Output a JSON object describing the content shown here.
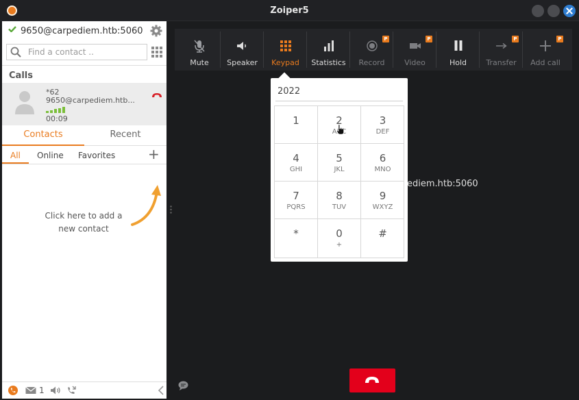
{
  "window": {
    "title": "Zoiper5"
  },
  "account": {
    "name": "9650@carpediem.htb:5060"
  },
  "search": {
    "placeholder": "Find a contact .."
  },
  "calls": {
    "header": "Calls",
    "items": [
      {
        "number": "*62",
        "account": "9650@carpediem.htb...",
        "duration": "00:09"
      }
    ]
  },
  "contacts": {
    "tabs": [
      "Contacts",
      "Recent"
    ],
    "filters": [
      "All",
      "Online",
      "Favorites"
    ],
    "add_hint": "Click here to add a new contact"
  },
  "footer": {
    "message_count": "1"
  },
  "toolbar": {
    "buttons": [
      {
        "label": "Mute",
        "icon": "mic-off-icon",
        "state": "normal"
      },
      {
        "label": "Speaker",
        "icon": "speaker-icon",
        "state": "normal"
      },
      {
        "label": "Keypad",
        "icon": "keypad-icon",
        "state": "active"
      },
      {
        "label": "Statistics",
        "icon": "bar-chart-icon",
        "state": "normal"
      },
      {
        "label": "Record",
        "icon": "record-icon",
        "state": "disabled",
        "badge": "P"
      },
      {
        "label": "Video",
        "icon": "video-icon",
        "state": "disabled",
        "badge": "P"
      },
      {
        "label": "Hold",
        "icon": "pause-icon",
        "state": "normal"
      },
      {
        "label": "Transfer",
        "icon": "transfer-icon",
        "state": "disabled",
        "badge": "P"
      },
      {
        "label": "Add call",
        "icon": "plus-icon",
        "state": "disabled",
        "badge": "P"
      }
    ]
  },
  "main": {
    "host_fragment": "ediem.htb:5060"
  },
  "keypad": {
    "display": "2022",
    "keys": [
      {
        "digit": "1",
        "letters": ""
      },
      {
        "digit": "2",
        "letters": "ABC"
      },
      {
        "digit": "3",
        "letters": "DEF"
      },
      {
        "digit": "4",
        "letters": "GHI"
      },
      {
        "digit": "5",
        "letters": "JKL"
      },
      {
        "digit": "6",
        "letters": "MNO"
      },
      {
        "digit": "7",
        "letters": "PQRS"
      },
      {
        "digit": "8",
        "letters": "TUV"
      },
      {
        "digit": "9",
        "letters": "WXYZ"
      },
      {
        "digit": "*",
        "letters": ""
      },
      {
        "digit": "0",
        "letters": "+"
      },
      {
        "digit": "#",
        "letters": ""
      }
    ]
  },
  "colors": {
    "accent": "#e97b1e",
    "hangup": "#e3001b",
    "background": "#1b1c1e",
    "toolbar": "#242528"
  }
}
